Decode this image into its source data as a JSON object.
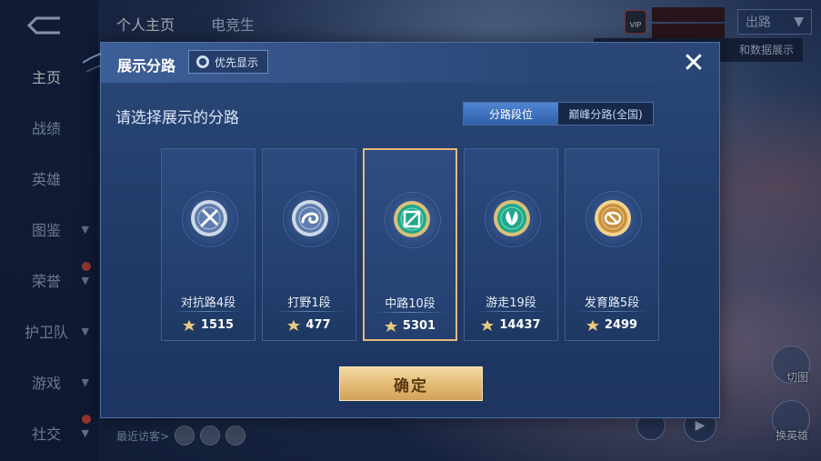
{
  "app": {
    "nav": [
      {
        "label": "主页",
        "active": true,
        "chevron": false,
        "dot": false
      },
      {
        "label": "战绩",
        "active": false,
        "chevron": false,
        "dot": false
      },
      {
        "label": "英雄",
        "active": false,
        "chevron": false,
        "dot": false
      },
      {
        "label": "图鉴",
        "active": false,
        "chevron": true,
        "dot": false
      },
      {
        "label": "荣誉",
        "active": false,
        "chevron": true,
        "dot": true
      },
      {
        "label": "护卫队",
        "active": false,
        "chevron": true,
        "dot": false
      },
      {
        "label": "游戏",
        "active": false,
        "chevron": true,
        "dot": false
      },
      {
        "label": "社交",
        "active": false,
        "chevron": true,
        "dot": true
      }
    ],
    "tabs": [
      "个人主页",
      "电竞生"
    ],
    "vip_text": "VIP",
    "route_dropdown": "出路",
    "data_show": "和数据展示",
    "recent_visitors": "最近访客>",
    "side_buttons": [
      "切图",
      "换英雄"
    ]
  },
  "modal": {
    "title": "展示分路",
    "priority_label": "优先显示",
    "prompt": "请选择展示的分路",
    "segments": [
      {
        "label": "分路段位",
        "active": true
      },
      {
        "label": "巅峰分路(全国)",
        "active": false
      }
    ],
    "cards": [
      {
        "label": "对抗路4段",
        "score": "1515",
        "selected": false,
        "medal": "silver",
        "emblem": "sword"
      },
      {
        "label": "打野1段",
        "score": "477",
        "selected": false,
        "medal": "silver",
        "emblem": "dragon"
      },
      {
        "label": "中路10段",
        "score": "5301",
        "selected": true,
        "medal": "green",
        "emblem": "slash"
      },
      {
        "label": "游走19段",
        "score": "14437",
        "selected": false,
        "medal": "green",
        "emblem": "leaf"
      },
      {
        "label": "发育路5段",
        "score": "2499",
        "selected": false,
        "medal": "gold",
        "emblem": "bow"
      }
    ],
    "confirm_label": "确定",
    "close_symbol": "✕"
  }
}
